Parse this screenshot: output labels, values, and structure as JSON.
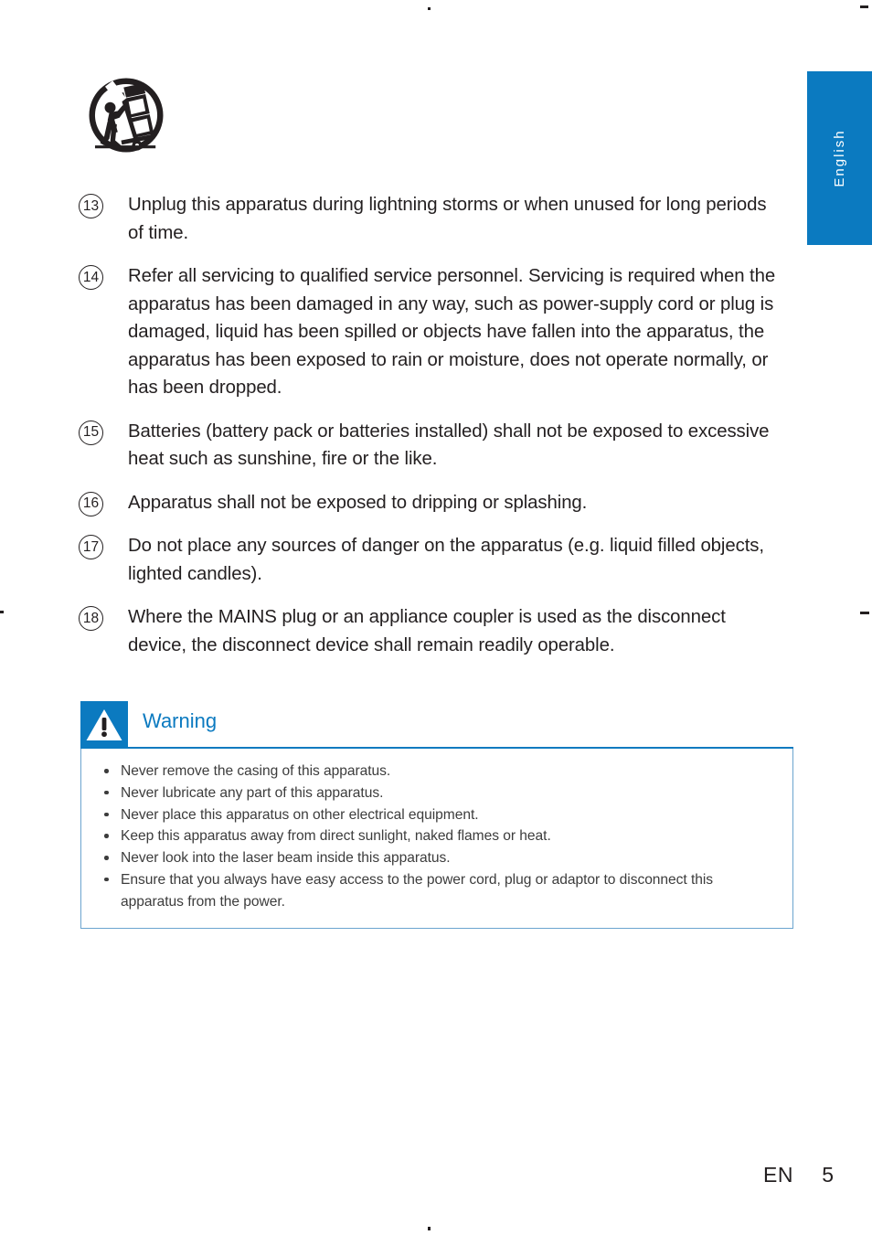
{
  "page": {
    "language_tab": "English",
    "accent_color": "#0b7ac0",
    "text_color": "#231f20"
  },
  "pictogram": {
    "name": "cart-tipping-warning-symbol",
    "description": "Do not place on unstable cart"
  },
  "safety_list": [
    {
      "number": "13",
      "text": "Unplug this apparatus during lightning storms or when unused for long periods of time."
    },
    {
      "number": "14",
      "text": "Refer all servicing to qualified service personnel. Servicing is required when the apparatus has been damaged in any way, such as power-supply cord or plug is damaged, liquid has been spilled or objects have fallen into the apparatus, the apparatus has been exposed to rain or moisture, does not operate normally, or has been dropped."
    },
    {
      "number": "15",
      "text": "Batteries (battery pack or batteries installed) shall not be exposed to excessive heat such as sunshine, fire or the like."
    },
    {
      "number": "16",
      "text": "Apparatus shall not be exposed to dripping or splashing."
    },
    {
      "number": "17",
      "text": "Do not place any sources of danger on the apparatus (e.g. liquid filled objects, lighted candles)."
    },
    {
      "number": "18",
      "text": "Where the MAINS plug or an appliance coupler is used as the disconnect device, the disconnect device shall remain readily operable."
    }
  ],
  "warning": {
    "title": "Warning",
    "icon": "warning-triangle-icon",
    "bullets": [
      "Never remove the casing of this apparatus.",
      "Never lubricate any part of this apparatus.",
      "Never place this apparatus on other electrical equipment.",
      "Keep this apparatus away from direct sunlight, naked flames or heat.",
      "Never look into the laser beam inside this apparatus.",
      "Ensure that you always have easy access to the power cord, plug or adaptor to disconnect this apparatus from the power."
    ]
  },
  "footer": {
    "language_code": "EN",
    "page_number": "5"
  }
}
